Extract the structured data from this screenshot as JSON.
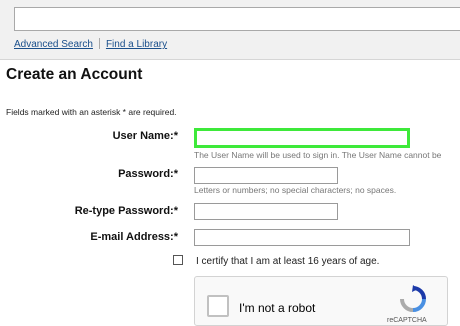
{
  "header": {
    "search": {
      "value": "",
      "placeholder": ""
    },
    "links": [
      {
        "label": "Advanced Search"
      },
      {
        "label": "Find a Library"
      }
    ]
  },
  "page": {
    "title": "Create an Account",
    "required_note": "Fields marked with an asterisk *  are required."
  },
  "form": {
    "username": {
      "label": "User Name:*",
      "value": "",
      "hint": "The User Name will be used to sign in. The User Name cannot be"
    },
    "password": {
      "label": "Password:*",
      "value": "",
      "hint": "Letters or numbers; no special characters; no spaces."
    },
    "retype_password": {
      "label": "Re-type Password:*",
      "value": ""
    },
    "email": {
      "label": "E-mail Address:*",
      "value": ""
    },
    "age_certify": {
      "label": "I certify that I am at least 16 years of age.",
      "checked": false
    }
  },
  "captcha": {
    "label": "I'm not a robot",
    "brand": "reCAPTCHA",
    "checked": false
  },
  "colors": {
    "focus_outline": "#3ee93a",
    "link": "#1a4f8b",
    "hint_text": "#777777"
  },
  "icons": [
    "recaptcha-icon"
  ]
}
